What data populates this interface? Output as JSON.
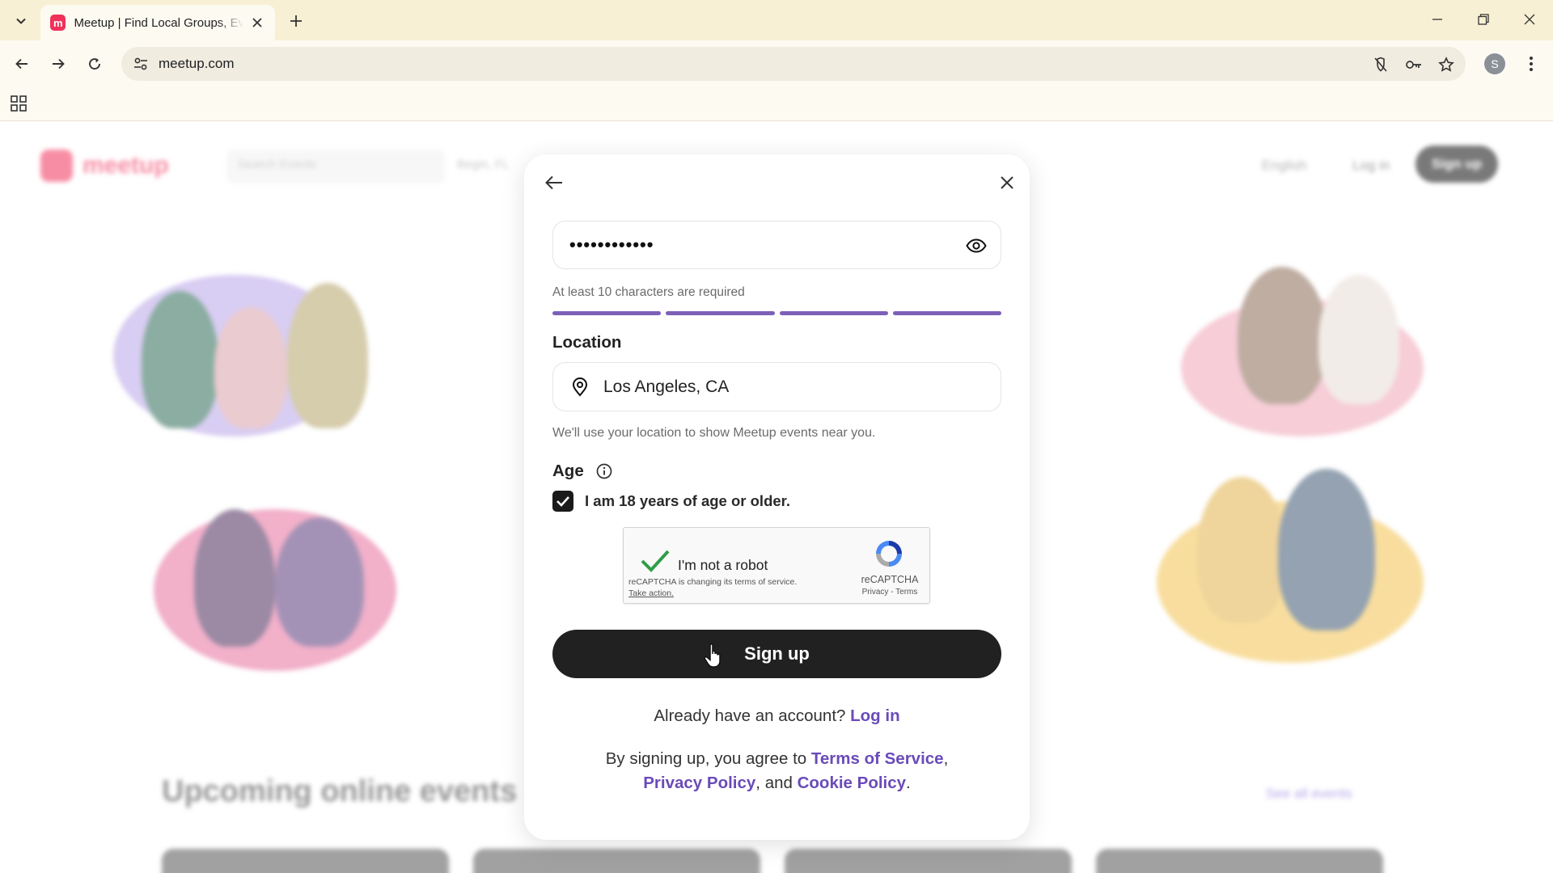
{
  "browser": {
    "tab_title": "Meetup | Find Local Groups, Events, and Activities",
    "tab_favicon_letter": "m",
    "url": "meetup.com",
    "profile_initial": "S"
  },
  "page_background": {
    "header": {
      "search_placeholder": "Search Events",
      "location_text": "Begin, FL",
      "language": "English",
      "login": "Log in",
      "signup": "Sign up"
    },
    "section_heading": "Upcoming online events",
    "see_all": "See all events"
  },
  "modal": {
    "password": {
      "value": "••••••••••••",
      "hint": "At least 10 characters are required",
      "strength_segments_filled": 4,
      "strength_segments_total": 4,
      "strength_color": "#7d5fb8"
    },
    "location": {
      "label": "Location",
      "value": "Los Angeles, CA",
      "hint": "We'll use your location to show Meetup events near you."
    },
    "age": {
      "label": "Age",
      "checkbox_label": "I am 18 years of age or older.",
      "checked": true
    },
    "recaptcha": {
      "label": "I'm not a robot",
      "note": "reCAPTCHA is changing its terms of service.",
      "action": "Take action.",
      "brand": "reCAPTCHA",
      "links": "Privacy - Terms"
    },
    "signup_button": "Sign up",
    "have_account": {
      "text": "Already have an account?",
      "link": "Log in"
    },
    "terms": {
      "prefix": "By signing up, you agree to",
      "terms_link": "Terms of Service",
      "sep1": ",",
      "privacy_link": "Privacy Policy",
      "sep2": ", and",
      "cookie_link": "Cookie Policy",
      "end": "."
    }
  },
  "colors": {
    "brand": "#f0315a",
    "link": "#6a4bb8",
    "button": "#212121"
  }
}
